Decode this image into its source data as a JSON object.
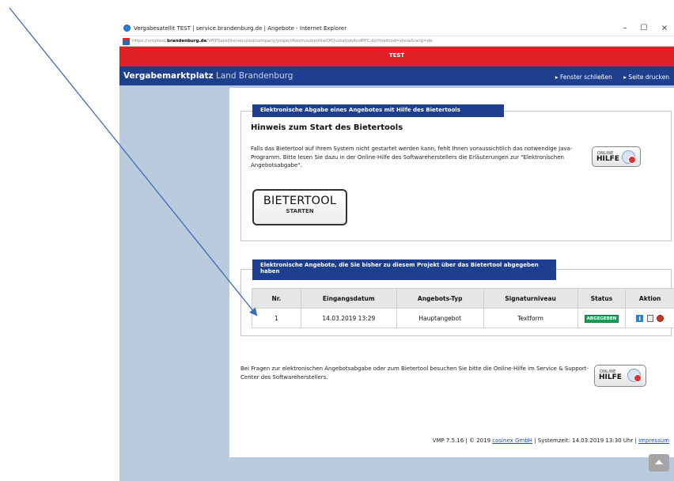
{
  "window": {
    "title": "Vergabesatellit TEST | service.brandenburg.de | Angebote - Internet Explorer",
    "minimize": "–",
    "maximize": "☐",
    "close": "×"
  },
  "address": {
    "scheme": "https://vmptest.",
    "host": "brandenburg.de",
    "path": "/VMPSatellite/secured/company/projectRoom/submittalOfQuotationAndPPC.do?method=show&lang=de"
  },
  "banner": {
    "label": "TEST"
  },
  "nav": {
    "brand_bold": "Vergabemarktplatz",
    "brand_light": "Land Brandenburg",
    "close_window": "▸ Fenster schließen",
    "print_page": "▸ Seite drucken"
  },
  "submission": {
    "header": "Elektronische Abgabe eines Angebotes mit Hilfe des Bietertools",
    "title": "Hinweis zum Start des Bietertools",
    "text": "Falls das Bietertool auf Ihrem System nicht gestartet werden kann, fehlt Ihnen voraussichtlich das notwendige Java-Programm. Bitte lesen Sie dazu in der Online-Hilfe des Softwareherstellers die Erläuterungen zur \"Elektronischen Angebotsabgabe\".",
    "start_button_line1": "BIETERTOOL",
    "start_button_line2": "STARTEN"
  },
  "online_help": {
    "line1": "ONLINE",
    "line2": "HILFE"
  },
  "offers": {
    "header": "Elektronische Angebote, die Sie bisher zu diesem Projekt über das Bietertool abgegeben haben",
    "columns": [
      "Nr.",
      "Eingangsdatum",
      "Angebots-Typ",
      "Signaturniveau",
      "Status",
      "Aktion"
    ],
    "rows": [
      {
        "nr": "1",
        "date": "14.03.2019 13:29",
        "type": "Hauptangebot",
        "signature": "Textform",
        "status": "ABGEGEBEN"
      }
    ],
    "status_color": "#1a9e5a"
  },
  "help": {
    "text": "Bei Fragen zur elektronischen Angebotsabgabe oder zum Bietertool besuchen Sie bitte die Online-Hilfe im Service & Support-Center des Softwareherstellers."
  },
  "footer": {
    "version": "VMP 7.5.16 | © 2019 ",
    "company": "cosinex GmbH",
    "systime": " | Systemzeit: 14.03.2019 13:30 Uhr | ",
    "imprint": "Impressum"
  },
  "colors": {
    "banner": "#e12127",
    "nav": "#1e3f8f",
    "sidebar": "#b9cbdd",
    "link": "#1b4fa8"
  }
}
